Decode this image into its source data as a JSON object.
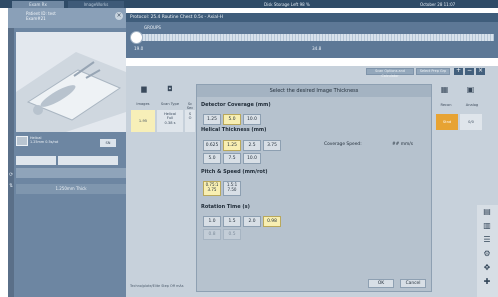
{
  "tabs": [
    {
      "label": "Exam Rx"
    },
    {
      "label": "ImageWorks"
    }
  ],
  "status": {
    "disk": "Disk Storage Left 98 %",
    "datetime": "October 28 11:07"
  },
  "patient": {
    "line1": "Patient ID: test",
    "line2": "Exam#21"
  },
  "scan_item": {
    "line1": "Helical",
    "line2": "1.25mm 0.5s/rot"
  },
  "scan_item_button": "SN",
  "lp_fields": {
    "field1": "",
    "field2": ""
  },
  "lp_band_1": "",
  "lp_band_2": "1.250mm Thick",
  "protocol": {
    "title": "Protocol: 25.4 Routine Chest 0.5s - Axial-H"
  },
  "timeline": {
    "label": "GROUPS",
    "start": "19.0",
    "mid": "34.8"
  },
  "scanpanel": {
    "top_btn1": "Scan Options and Calculator",
    "top_btn2": "Select Prep Grp",
    "ctrl_plus": "+",
    "ctrl_minus": "−",
    "ctrl_x": "×",
    "col_headers": [
      "Images",
      "Scan Type",
      "Sc Sec"
    ],
    "col_cells": [
      "1-95",
      "Helical\nFull\n0.38 s",
      "S\nO"
    ],
    "footer": "Techno/plate/Elite Step Off mAs"
  },
  "dialog": {
    "title": "Select the desired Image Thickness",
    "detector": {
      "label": "Detector Coverage (mm)",
      "options": [
        {
          "label": "1.25",
          "state": "normal"
        },
        {
          "label": "5.0",
          "state": "selected"
        },
        {
          "label": "10.0",
          "state": "normal"
        }
      ]
    },
    "helical": {
      "label": "Helical Thickness (mm)",
      "options": [
        {
          "label": "0.625",
          "state": "normal"
        },
        {
          "label": "1.25",
          "state": "selected"
        },
        {
          "label": "2.5",
          "state": "normal"
        },
        {
          "label": "3.75",
          "state": "normal"
        },
        {
          "label": "5.0",
          "state": "normal"
        },
        {
          "label": "7.5",
          "state": "normal"
        },
        {
          "label": "10.0",
          "state": "normal"
        }
      ]
    },
    "coverage_speed": {
      "label": "Coverage Speed:",
      "value": "## mm/s"
    },
    "pitch": {
      "label": "Pitch & Speed (mm/rot)",
      "options": [
        {
          "line1": "0.75:1",
          "line2": "3.75",
          "state": "selected"
        },
        {
          "line1": "1.5:1",
          "line2": "7.50",
          "state": "normal"
        }
      ]
    },
    "rotation": {
      "label": "Rotation Time (s)",
      "options": [
        {
          "label": "1.0",
          "state": "normal"
        },
        {
          "label": "1.5",
          "state": "normal"
        },
        {
          "label": "2.0",
          "state": "normal"
        },
        {
          "label": "0.98",
          "state": "selected"
        },
        {
          "label": "0.8",
          "state": "disabled"
        },
        {
          "label": "0.5",
          "state": "disabled"
        }
      ]
    },
    "ok_label": "OK",
    "cancel_label": "Cancel"
  },
  "rightpanel": {
    "headers": [
      "Recon",
      "Analog"
    ],
    "orange_cell": "Stnd",
    "cell": "0/0"
  },
  "colors": {
    "accent_orange": "#e7a333",
    "selected_yellow": "#f8efb2",
    "header_blue": "#2f4b67"
  }
}
